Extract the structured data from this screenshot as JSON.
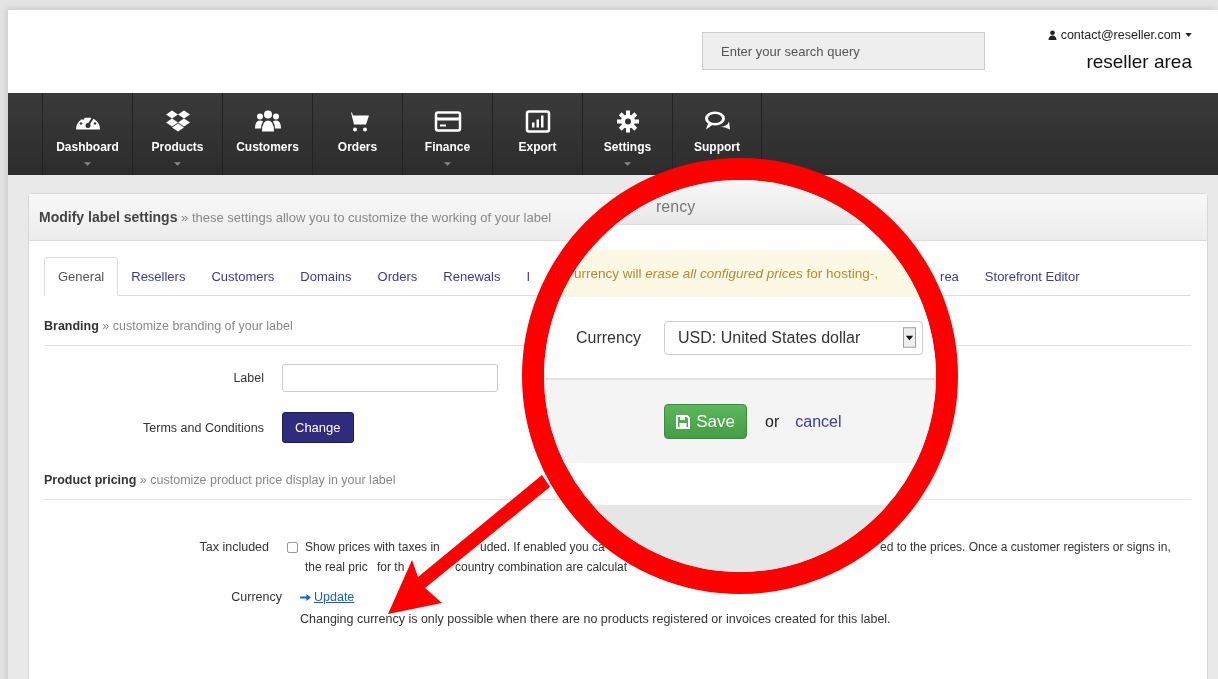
{
  "header": {
    "search": {
      "placeholder": "Enter your search query"
    },
    "account": "contact@reseller.com",
    "area_title": "reseller area"
  },
  "nav": [
    {
      "label": "Dashboard",
      "has_menu": true
    },
    {
      "label": "Products",
      "has_menu": true
    },
    {
      "label": "Customers",
      "has_menu": false
    },
    {
      "label": "Orders",
      "has_menu": false
    },
    {
      "label": "Finance",
      "has_menu": true
    },
    {
      "label": "Export",
      "has_menu": false
    },
    {
      "label": "Settings",
      "has_menu": true
    },
    {
      "label": "Support",
      "has_menu": false
    }
  ],
  "panel": {
    "title": "Modify label settings",
    "subtitle": "» these settings allow you to customize the working of your label"
  },
  "tabs": [
    {
      "label": "General",
      "selected": true
    },
    {
      "label": "Resellers",
      "selected": false
    },
    {
      "label": "Customers",
      "selected": false
    },
    {
      "label": "Domains",
      "selected": false
    },
    {
      "label": "Orders",
      "selected": false
    },
    {
      "label": "Renewals",
      "selected": false
    },
    {
      "label": "I",
      "selected": false
    },
    {
      "label": "rea",
      "selected": false
    },
    {
      "label": "Storefront Editor",
      "selected": false
    }
  ],
  "branding": {
    "title": "Branding",
    "subtitle": "» customize branding of your label",
    "label_field": {
      "label": "Label"
    },
    "terms": {
      "label": "Terms and Conditions",
      "button": "Change"
    }
  },
  "pricing": {
    "title": "Product pricing",
    "subtitle": "» customize product price display in your label",
    "tax": {
      "label": "Tax included",
      "checked": false,
      "lines": [
        [
          "Show prices with taxes in",
          "uded. If enabled you ca",
          "ed to the prices. Once a customer registers or signs in,"
        ],
        [
          "the real pric",
          "for th",
          "country combination are calculat"
        ]
      ]
    },
    "currency": {
      "label": "Currency",
      "link": "Update",
      "note": "Changing currency is only possible when there are no products registered or invoices created for this label."
    }
  },
  "magnifier": {
    "title": "rency",
    "warning": "urrency will *erase all configured prices* for hosting-,",
    "field_label": "Currency",
    "select_value": "USD: United States dollar",
    "save": "Save",
    "or": "or",
    "cancel": "cancel"
  }
}
